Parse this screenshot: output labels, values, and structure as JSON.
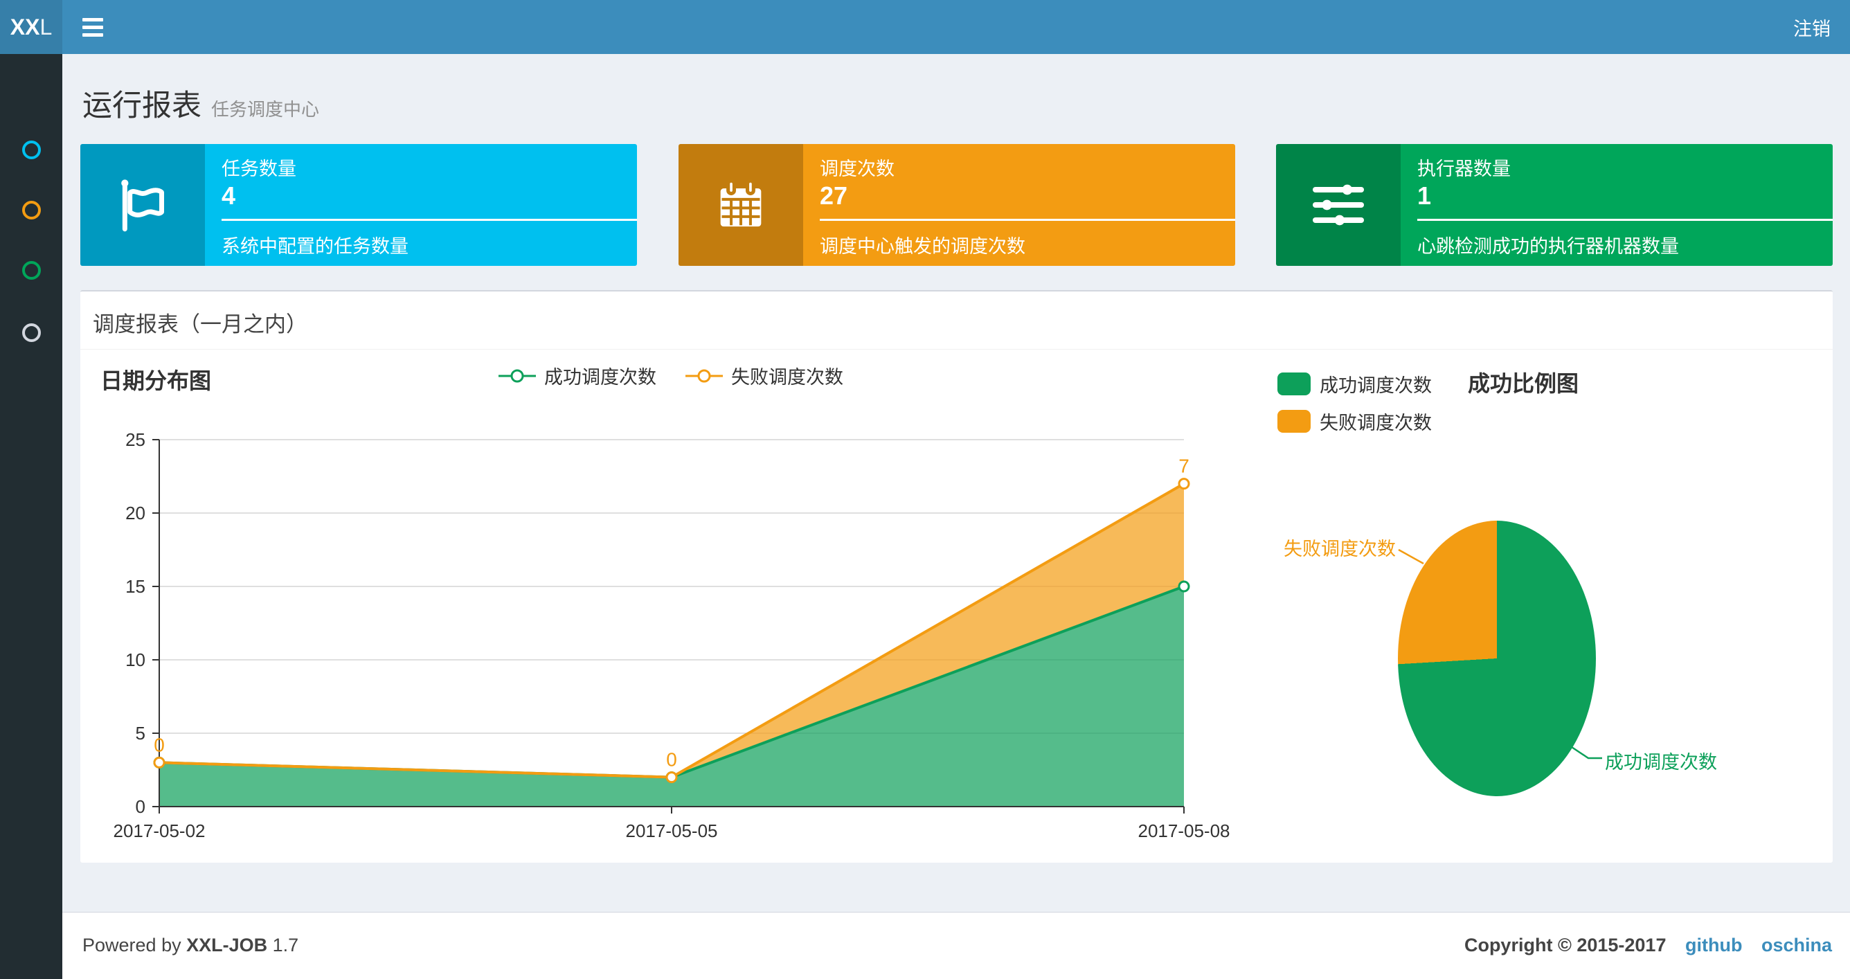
{
  "navbar": {
    "logo_bold": "XX",
    "logo_light": "L",
    "logout_label": "注销"
  },
  "sidebar": {
    "items": [
      {
        "color": "#00c0ef"
      },
      {
        "color": "#f39c12"
      },
      {
        "color": "#00a65a"
      },
      {
        "color": "#d2d6de"
      }
    ]
  },
  "page_header": {
    "title": "运行报表",
    "subtitle": "任务调度中心"
  },
  "info_boxes": [
    {
      "title": "任务数量",
      "value": "4",
      "desc": "系统中配置的任务数量",
      "color": "#00c0ef",
      "icon": "flag-icon"
    },
    {
      "title": "调度次数",
      "value": "27",
      "desc": "调度中心触发的调度次数",
      "color": "#f39c12",
      "icon": "calendar-icon"
    },
    {
      "title": "执行器数量",
      "value": "1",
      "desc": "心跳检测成功的执行器机器数量",
      "color": "#00a65a",
      "icon": "sliders-icon"
    }
  ],
  "panel": {
    "title": "调度报表（一月之内）"
  },
  "chart_data": [
    {
      "type": "area",
      "title": "日期分布图",
      "x": [
        "2017-05-02",
        "2017-05-05",
        "2017-05-08"
      ],
      "series": [
        {
          "name": "成功调度次数",
          "values": [
            3,
            2,
            15
          ],
          "color": "#0da05a"
        },
        {
          "name": "失败调度次数",
          "values": [
            0,
            0,
            7
          ],
          "color": "#f39c12"
        }
      ],
      "stacked": true,
      "point_labels_series": "失败调度次数",
      "point_labels": [
        0,
        0,
        7
      ],
      "ylim": [
        0,
        25
      ],
      "ytick_step": 5,
      "grid": "horizontal",
      "legend_position": "top-center"
    },
    {
      "type": "pie",
      "title": "成功比例图",
      "slices": [
        {
          "label": "成功调度次数",
          "value": 20,
          "color": "#0da05a"
        },
        {
          "label": "失败调度次数",
          "value": 7,
          "color": "#f39c12"
        }
      ],
      "legend_position": "top-left"
    }
  ],
  "footer": {
    "powered_prefix": "Powered by",
    "product": "XXL-JOB",
    "version": "1.7",
    "copyright": "Copyright © 2015-2017",
    "links": [
      {
        "label": "github"
      },
      {
        "label": "oschina"
      }
    ]
  }
}
